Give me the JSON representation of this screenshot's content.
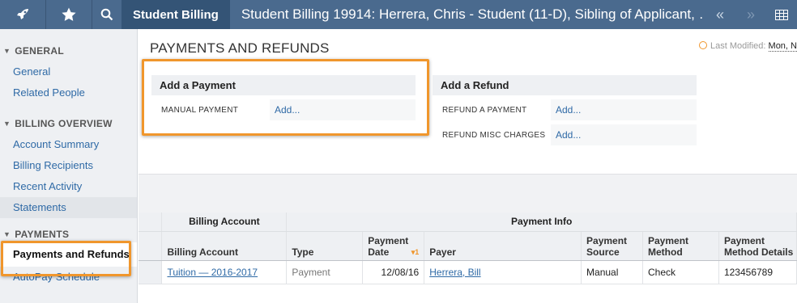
{
  "topbar": {
    "app_crumb": "Student Billing",
    "title": "Student Billing 19914: Herrera, Chris - Student (11-D), Sibling of Applicant, …"
  },
  "sidebar": {
    "sections": [
      {
        "title": "GENERAL",
        "items": [
          "General",
          "Related People"
        ]
      },
      {
        "title": "BILLING OVERVIEW",
        "items": [
          "Account Summary",
          "Billing Recipients",
          "Recent Activity",
          "Statements"
        ]
      },
      {
        "title": "PAYMENTS",
        "items": [
          "Payments and Refunds",
          "AutoPay Schedule"
        ]
      }
    ]
  },
  "main": {
    "page_title": "PAYMENTS AND REFUNDS",
    "last_modified_label": "Last Modified:",
    "last_modified_value": "Mon, N",
    "add_payment": {
      "title": "Add a Payment",
      "rows": [
        {
          "label": "MANUAL PAYMENT",
          "action": "Add..."
        }
      ]
    },
    "add_refund": {
      "title": "Add a Refund",
      "rows": [
        {
          "label": "REFUND A PAYMENT",
          "action": "Add..."
        },
        {
          "label": "REFUND MISC CHARGES",
          "action": "Add..."
        }
      ]
    },
    "table": {
      "group_headers": [
        "Billing Account",
        "Payment Info"
      ],
      "columns": [
        "Billing Account",
        "Type",
        "Payment Date",
        "Payer",
        "Payment Source",
        "Payment Method",
        "Payment Method Details"
      ],
      "sort_indicator": "1",
      "rows": [
        {
          "billing_account": "Tuition — 2016-2017",
          "type": "Payment",
          "payment_date": "12/08/16",
          "payer": "Herrera, Bill",
          "payment_source": "Manual",
          "payment_method": "Check",
          "payment_method_details": "123456789"
        }
      ]
    }
  },
  "colors": {
    "topbar": "#4a6a8e",
    "crumb": "#345476",
    "link": "#2f6aa6",
    "highlight": "#f0962c"
  }
}
